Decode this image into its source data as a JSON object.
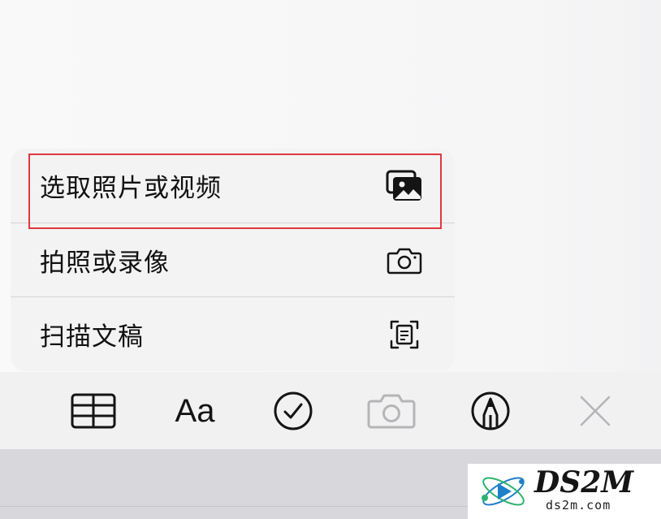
{
  "menu": {
    "items": [
      {
        "label": "选取照片或视频",
        "icon": "photo-library-icon"
      },
      {
        "label": "拍照或录像",
        "icon": "camera-icon"
      },
      {
        "label": "扫描文稿",
        "icon": "document-scan-icon"
      }
    ],
    "highlighted_index": 0,
    "highlight_color": "#e0393e"
  },
  "toolbar": {
    "items": [
      {
        "name": "table-icon"
      },
      {
        "name": "text-format-icon",
        "text": "Aa"
      },
      {
        "name": "checklist-icon"
      },
      {
        "name": "camera-icon",
        "state": "disabled"
      },
      {
        "name": "markup-pen-icon"
      },
      {
        "name": "close-icon"
      }
    ]
  },
  "watermark": {
    "title": "DS2M",
    "subtitle": "ds2m.com"
  },
  "colors": {
    "menu_bg": "#f3f3f4",
    "toolbar_bg": "#f1f1f2",
    "icon_disabled": "#b5b5b8",
    "icon_active": "#141414"
  }
}
